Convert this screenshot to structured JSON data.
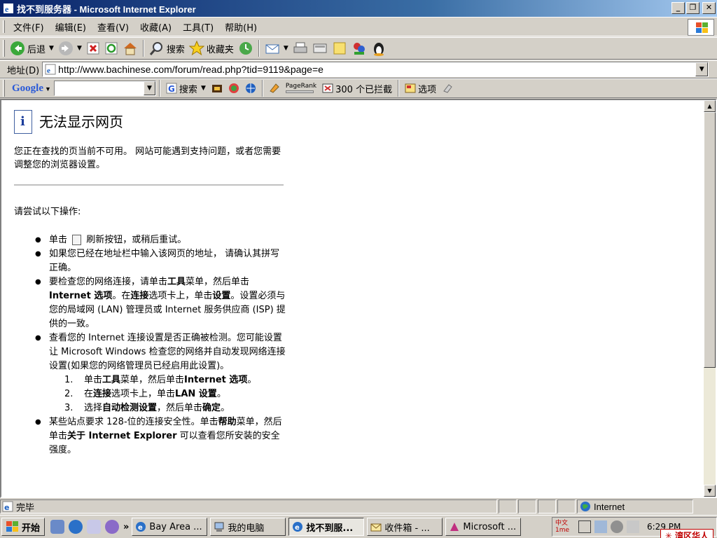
{
  "window": {
    "title": "找不到服务器 - Microsoft Internet Explorer",
    "minimize": "_",
    "restore": "❐",
    "close": "✕"
  },
  "menu": [
    "文件(F)",
    "编辑(E)",
    "查看(V)",
    "收藏(A)",
    "工具(T)",
    "帮助(H)"
  ],
  "toolbar": {
    "back_label": "后退",
    "search_label": "搜索",
    "favorites_label": "收藏夹"
  },
  "address": {
    "label": "地址(D)",
    "url": "http://www.bachinese.com/forum/read.php?tid=9119&page=e"
  },
  "google": {
    "logo": "Google",
    "search_label": "搜索",
    "pagerank_label": "PageRank",
    "blocked_label": "300 个已拦截",
    "options_label": "选项"
  },
  "page": {
    "title": "无法显示网页",
    "description": "您正在查找的页当前不可用。 网站可能遇到支持问题，或者您需要 调整您的浏览器设置。",
    "try_heading": "请尝试以下操作:",
    "b1_pre": "单击",
    "b1_post": "刷新按钮，或稍后重试。",
    "b2": "如果您已经在地址栏中输入该网页的地址， 请确认其拼写正确。",
    "b3_a": "要检查您的网络连接，请单击",
    "b3_tools": "工具",
    "b3_b": "菜单，然后单击",
    "b3_ie_options": "Internet 选项",
    "b3_c": "。在",
    "b3_connections": "连接",
    "b3_d": "选项卡上，单击",
    "b3_settings": "设置",
    "b3_e": "。设置必须与您的局域网 (LAN) 管理员或 Internet 服务供应商 (ISP) 提供的一致。",
    "b4": "查看您的 Internet 连接设置是否正确被检测。您可能设置让 Microsoft Windows 检查您的网络并自动发现网络连接设置(如果您的网络管理员已经启用此设置)。",
    "s1_num": "1.",
    "s1_a": "单击",
    "s1_tools": "工具",
    "s1_b": "菜单，然后单击",
    "s1_ie": "Internet 选项",
    "s1_c": "。",
    "s2_num": "2.",
    "s2_a": "在",
    "s2_conn": "连接",
    "s2_b": "选项卡上，单击",
    "s2_lan": "LAN 设置",
    "s2_c": "。",
    "s3_num": "3.",
    "s3_a": "选择",
    "s3_auto": "自动检测设置",
    "s3_b": "，然后单击",
    "s3_ok": "确定",
    "s3_c": "。",
    "b5_a": "某些站点要求 128-位的连接安全性。单击",
    "b5_help": "帮助",
    "b5_b": "菜单，然后单击",
    "b5_about": "关于 Internet Explorer",
    "b5_c": " 可以查看您所安装的安全强度。"
  },
  "status": {
    "text": "完毕",
    "zone": "Internet"
  },
  "taskbar": {
    "start_label": "开始",
    "chevron": "»",
    "tasks": [
      {
        "label": "Bay Area ..."
      },
      {
        "label": "我的电脑"
      },
      {
        "label": "找不到服..."
      },
      {
        "label": "收件箱 - ..."
      },
      {
        "label": "Microsoft ..."
      }
    ],
    "ime_label": "中文1me",
    "clock": "6:29 PM",
    "watermark": "✳ 湾区华人"
  },
  "colors": {
    "title_start": "#0a246a",
    "title_end": "#a6caf0",
    "chrome": "#d4d0c8"
  }
}
